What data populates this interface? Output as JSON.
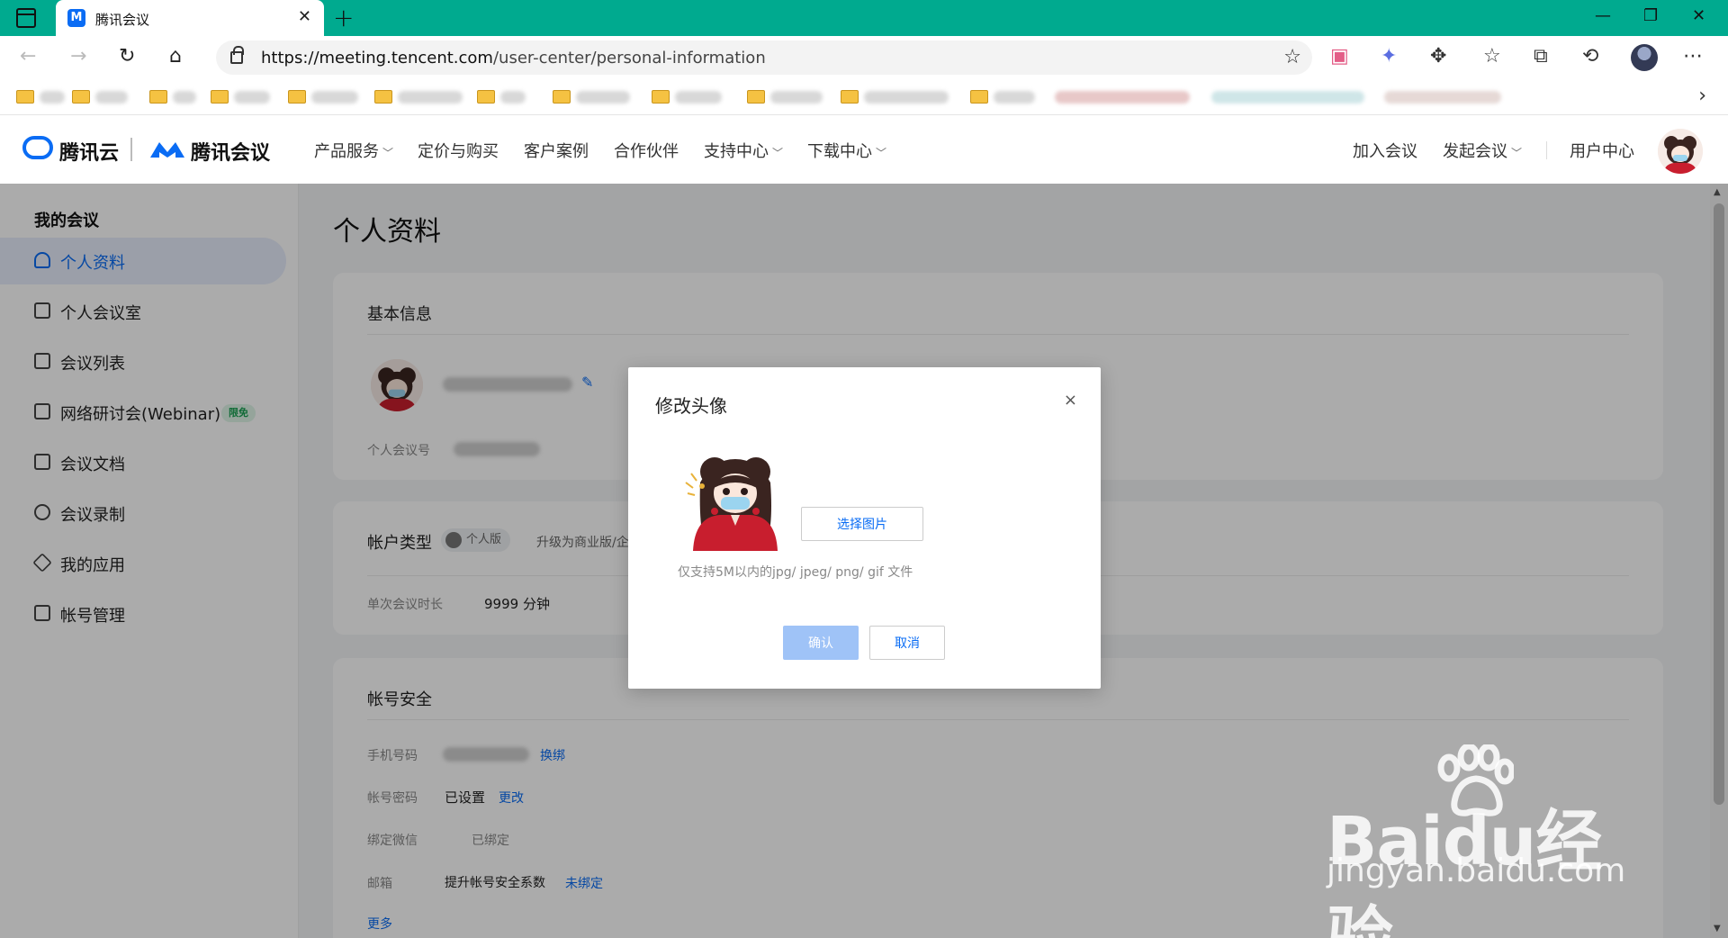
{
  "browser": {
    "tab_title": "腾讯会议",
    "tab_favicon_text": "M",
    "url_host": "https://meeting.tencent.com",
    "url_path": "/user-center/personal-information"
  },
  "header": {
    "logo_cloud": "腾讯云",
    "logo_meeting": "腾讯会议",
    "nav": [
      "产品服务",
      "定价与购买",
      "客户案例",
      "合作伙伴",
      "支持中心",
      "下载中心"
    ],
    "join_meeting": "加入会议",
    "start_meeting": "发起会议",
    "user_center": "用户中心"
  },
  "sidebar": {
    "heading": "我的会议",
    "items": [
      {
        "label": "个人资料",
        "icon": "user-icon"
      },
      {
        "label": "个人会议室",
        "icon": "room-icon"
      },
      {
        "label": "会议列表",
        "icon": "list-icon"
      },
      {
        "label": "网络研讨会(Webinar)",
        "icon": "webinar-icon",
        "badge": "限免"
      },
      {
        "label": "会议文档",
        "icon": "document-icon"
      },
      {
        "label": "会议录制",
        "icon": "record-icon"
      },
      {
        "label": "我的应用",
        "icon": "apps-icon"
      },
      {
        "label": "帐号管理",
        "icon": "account-icon"
      }
    ]
  },
  "main": {
    "page_title": "个人资料",
    "basic_info": {
      "title": "基本信息",
      "meeting_id_label": "个人会议号"
    },
    "account_type": {
      "title": "帐户类型",
      "badge": "个人版",
      "upgrade_text": "升级为商业版/企",
      "duration_label": "单次会议时长",
      "duration_value": "9999 分钟"
    },
    "security": {
      "title": "帐号安全",
      "phone_label": "手机号码",
      "phone_action": "换绑",
      "password_label": "帐号密码",
      "password_value": "已设置",
      "password_action": "更改",
      "wechat_label": "绑定微信",
      "wechat_value": "已绑定",
      "email_label": "邮箱",
      "email_value": "提升帐号安全系数",
      "email_action": "未绑定",
      "more": "更多"
    }
  },
  "dialog": {
    "title": "修改头像",
    "close": "×",
    "select_button": "选择图片",
    "hint": "仅支持5M以内的jpg/ jpeg/ png/ gif 文件",
    "confirm": "确认",
    "cancel": "取消"
  },
  "watermark": {
    "big": "Baidu经验",
    "small": "jingyan.baidu.com"
  },
  "colors": {
    "tabbar": "#00aa8f",
    "accent": "#0a6cf4",
    "confirm_disabled": "#9fc3f7"
  }
}
